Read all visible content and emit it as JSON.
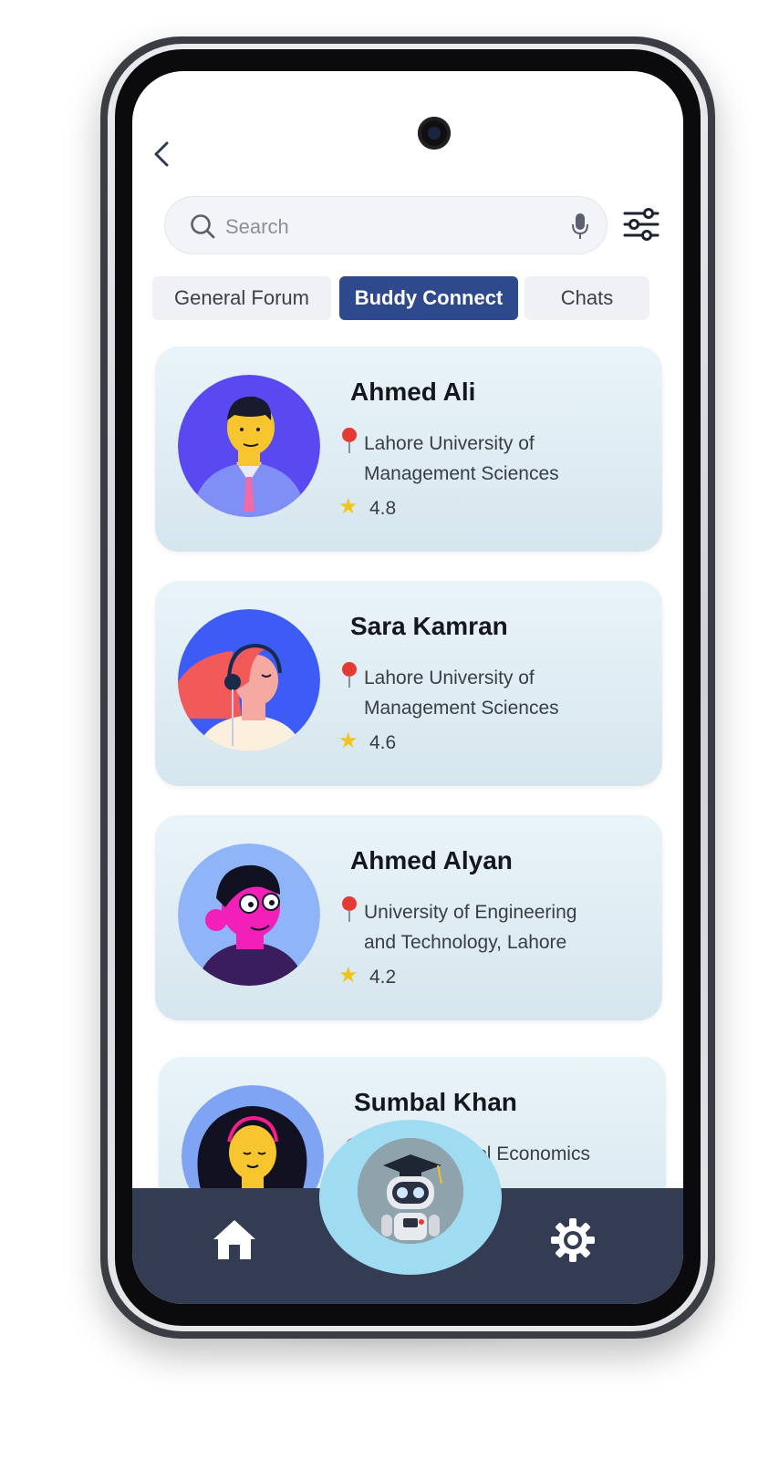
{
  "search": {
    "placeholder": "Search"
  },
  "tabs": [
    {
      "label": "General Forum",
      "active": false
    },
    {
      "label": "Buddy Connect",
      "active": true
    },
    {
      "label": "Chats",
      "active": false
    }
  ],
  "buddies": [
    {
      "name": "Ahmed Ali",
      "university_line1": "Lahore University of",
      "university_line2": "Management Sciences",
      "rating": "4.8"
    },
    {
      "name": "Sara Kamran",
      "university_line1": "Lahore University of",
      "university_line2": "Management Sciences",
      "rating": "4.6"
    },
    {
      "name": "Ahmed Alyan",
      "university_line1": "University of Engineering",
      "university_line2": "and Technology, Lahore",
      "rating": "4.2"
    },
    {
      "name": "Sumbal Khan",
      "university_line1": "Lahore School Economics",
      "university_line2": "",
      "rating": ""
    }
  ],
  "nav": {
    "left_icon": "home-icon",
    "center_icon": "robot-assistant-icon",
    "right_icon": "gear-icon"
  },
  "colors": {
    "accent": "#2f4a8c",
    "nav_bg": "#333c52",
    "bubble": "#9fdcf1",
    "star": "#f2c318"
  }
}
